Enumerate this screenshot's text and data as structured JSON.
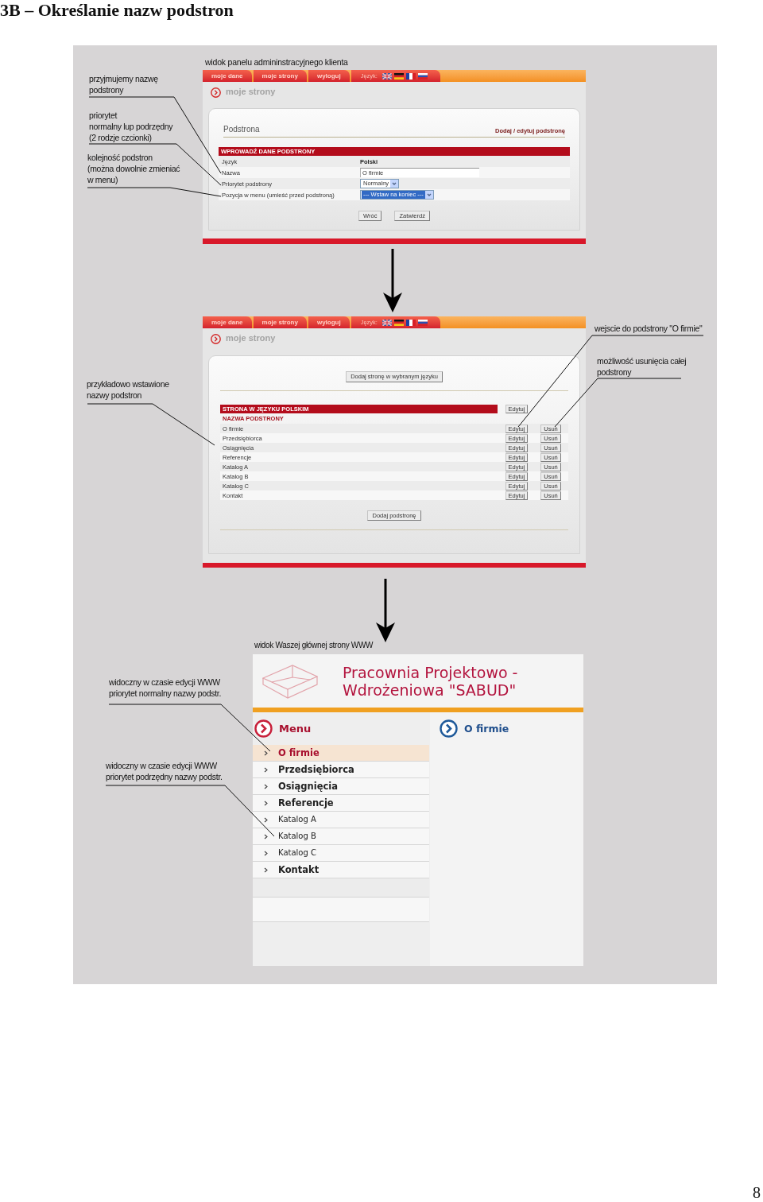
{
  "page": {
    "heading": "3B – Określanie nazw podstron",
    "page_number": "8"
  },
  "admin_edit_view": {
    "caption": "widok panelu admininstracyjnego klienta",
    "nav": {
      "tabs": [
        {
          "label": "moje dane"
        },
        {
          "label": "moje strony"
        },
        {
          "label": "wyloguj"
        }
      ],
      "language_label": "Język:"
    },
    "section_title": "moje strony",
    "panel_title": "Podstrona",
    "panel_link": "Dodaj / edytuj podstronę",
    "form_title": "WPROWADŹ DANE PODSTRONY",
    "fields": [
      {
        "label": "Język",
        "kind": "static",
        "value": "Polski"
      },
      {
        "label": "Nazwa",
        "kind": "text",
        "value": "O firmie"
      },
      {
        "label": "Priorytet podstrony",
        "kind": "select",
        "value": "Normalny",
        "highlighted": false
      },
      {
        "label": "Pozycja w menu (umieść przed podstroną)",
        "kind": "select",
        "value": "--- Wstaw na koniec ---",
        "highlighted": true
      }
    ],
    "buttons": [
      "Wróć",
      "Zatwierdź"
    ]
  },
  "admin_list_view": {
    "nav": {
      "tabs": [
        {
          "label": "moje dane"
        },
        {
          "label": "moje strony"
        },
        {
          "label": "wyloguj"
        }
      ],
      "language_label": "Język:"
    },
    "section_title": "moje strony",
    "add_language_button": "Dodaj stronę w wybranym języku",
    "language_header": "STRONA W JĘZYKU POLSKIM",
    "language_edit_button": "Edytuj",
    "column_header": "NAZWA PODSTRONY",
    "rows": [
      {
        "name": "O firmie",
        "edit": "Edytuj",
        "delete": "Usuń"
      },
      {
        "name": "Przedsiębiorca",
        "edit": "Edytuj",
        "delete": "Usuń"
      },
      {
        "name": "Osiągnięcia",
        "edit": "Edytuj",
        "delete": "Usuń"
      },
      {
        "name": "Referencje",
        "edit": "Edytuj",
        "delete": "Usuń"
      },
      {
        "name": "Katalog A",
        "edit": "Edytuj",
        "delete": "Usuń"
      },
      {
        "name": "Katalog B",
        "edit": "Edytuj",
        "delete": "Usuń"
      },
      {
        "name": "Katalog C",
        "edit": "Edytuj",
        "delete": "Usuń"
      },
      {
        "name": "Kontakt",
        "edit": "Edytuj",
        "delete": "Usuń"
      }
    ],
    "add_button": "Dodaj podstronę"
  },
  "website_view": {
    "caption": "widok Waszej głównej strony WWW",
    "title_lines": [
      "Pracownia Projektowo -",
      "Wdrożeniowa \"SABUD\""
    ],
    "menu_title": "Menu",
    "menu_items": [
      {
        "label": "O firmie",
        "kind": "normal",
        "selected": true
      },
      {
        "label": "Przedsiębiorca",
        "kind": "normal",
        "selected": false
      },
      {
        "label": "Osiągnięcia",
        "kind": "normal",
        "selected": false
      },
      {
        "label": "Referencje",
        "kind": "normal",
        "selected": false
      },
      {
        "label": "Katalog A",
        "kind": "subordinate",
        "selected": false
      },
      {
        "label": "Katalog B",
        "kind": "subordinate",
        "selected": false
      },
      {
        "label": "Katalog C",
        "kind": "subordinate",
        "selected": false
      },
      {
        "label": "Kontakt",
        "kind": "normal",
        "selected": false
      }
    ],
    "content_title": "O firmie"
  },
  "annotations": [
    {
      "lines": [
        "przyjmujemy nazwę",
        "podstrony"
      ]
    },
    {
      "lines": [
        "priorytet",
        "normalny lup podrzędny",
        "(2 rodzje czcionki)"
      ]
    },
    {
      "lines": [
        "kolejność podstron",
        "(można dowolnie zmieniać",
        "w menu)"
      ]
    },
    {
      "lines": [
        "przykładowo wstawione",
        "nazwy podstron"
      ]
    },
    {
      "lines": [
        "wejscie do podstrony \"O firmie\""
      ]
    },
    {
      "lines": [
        "możliwość usunięcia całej",
        "podstrony"
      ]
    },
    {
      "lines": [
        "widoczny w czasie edycji WWW",
        "priorytet normalny nazwy podstr."
      ]
    },
    {
      "lines": [
        "widoczny w czasie edycji WWW",
        "priorytet podrzędny nazwy podstr."
      ]
    }
  ]
}
